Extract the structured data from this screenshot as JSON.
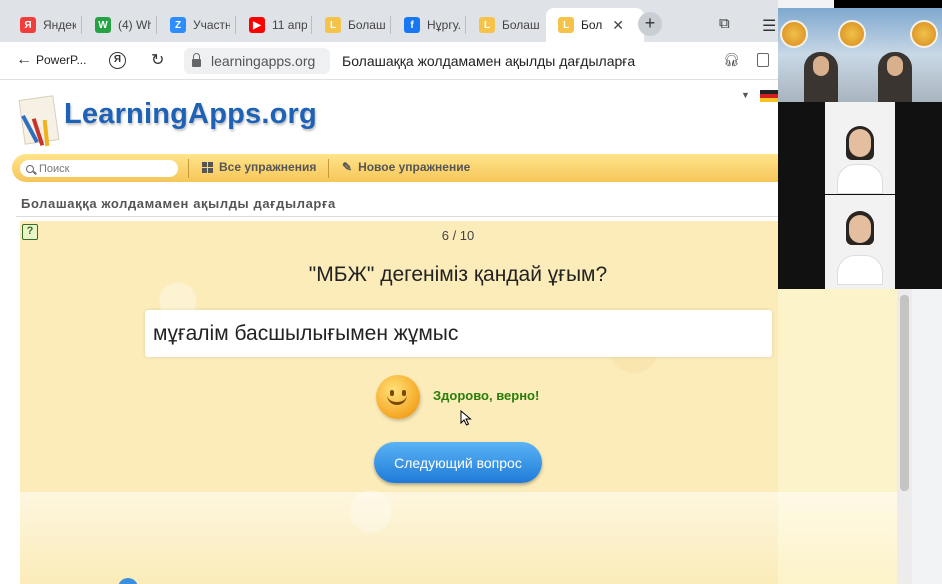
{
  "browser": {
    "tabs": [
      {
        "label": "Яндек",
        "icon": "yandex-icon",
        "color": "#f23d3d",
        "glyph": "Я"
      },
      {
        "label": "(4) Wh",
        "icon": "whatsapp-icon",
        "color": "#25a244",
        "glyph": "W"
      },
      {
        "label": "Участн",
        "icon": "zoom-icon",
        "color": "#2d8cff",
        "glyph": "Z"
      },
      {
        "label": "11 апр",
        "icon": "youtube-icon",
        "color": "#ff0000",
        "glyph": "▶"
      },
      {
        "label": "Болаш",
        "icon": "learningapps-icon",
        "color": "#f5c24a",
        "glyph": "L"
      },
      {
        "label": "Нұргул",
        "icon": "facebook-icon",
        "color": "#1877f2",
        "glyph": "f"
      },
      {
        "label": "Болаш",
        "icon": "learningapps-icon",
        "color": "#f5c24a",
        "glyph": "L"
      },
      {
        "label": "Бол",
        "icon": "learningapps-icon",
        "color": "#f5c24a",
        "glyph": "L",
        "active": true
      }
    ],
    "back_label": "PowerP...",
    "url": "learningapps.org",
    "page_title": "Болашаққа жолдамамен ақылды дағдыларға"
  },
  "site": {
    "logo": "LearningApps.org",
    "search_placeholder": "Поиск",
    "nav_all": "Все упражнения",
    "nav_new": "Новое упражнение",
    "exercise_title": "Болашаққа жолдамамен ақылды дағдыларға"
  },
  "exercise": {
    "progress": "6 / 10",
    "question": "\"МБЖ\" дегеніміз қандай ұғым?",
    "answer": "мұғалім басшылығымен жұмыс",
    "feedback": "Здорово, верно!",
    "next_button": "Следующий вопрос"
  },
  "colors": {
    "accent": "#1f7bd8",
    "logo": "#1d62b6",
    "success": "#2a7d0b",
    "navbar": "#f6c659",
    "exercise_bg": "#fbecb9"
  }
}
